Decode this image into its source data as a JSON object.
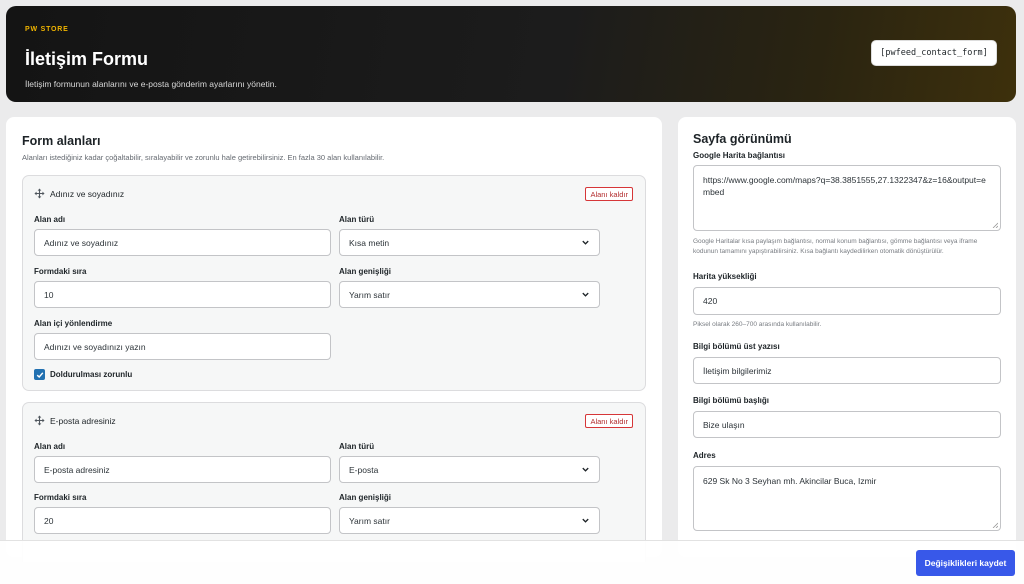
{
  "header": {
    "brand": "PW STORE",
    "title": "İletişim Formu",
    "subtitle": "İletişim formunun alanlarını ve e-posta gönderim ayarlarını yönetin.",
    "shortcode": "[pwfeed_contact_form]",
    "accent_color": "#f0b400"
  },
  "form_fields": {
    "title": "Form alanları",
    "description": "Alanları istediğiniz kadar çoğaltabilir, sıralayabilir ve zorunlu hale getirebilirsiniz. En fazla 30 alan kullanılabilir.",
    "labels": {
      "name": "Alan adı",
      "type": "Alan türü",
      "order": "Formdaki sıra",
      "width": "Alan genişliği",
      "placeholder": "Alan içi yönlendirme",
      "required": "Doldurulması zorunlu",
      "remove": "Alanı kaldır"
    },
    "fields": [
      {
        "heading": "Adınız ve soyadınız",
        "name": "Adınız ve soyadınız",
        "type": "Kısa metin",
        "order": "10",
        "width": "Yarım satır",
        "placeholder": "Adınızı ve soyadınızı yazın",
        "required": true
      },
      {
        "heading": "E-posta adresiniz",
        "name": "E-posta adresiniz",
        "type": "E-posta",
        "order": "20",
        "width": "Yarım satır"
      }
    ]
  },
  "page_view": {
    "title": "Sayfa görünümü",
    "map_link_label": "Google Harita bağlantısı",
    "map_link_value": "https://www.google.com/maps?q=38.3851555,27.1322347&z=16&output=embed",
    "map_link_help": "Google Haritalar kısa paylaşım bağlantısı, normal konum bağlantısı, gömme bağlantısı veya iframe kodunun tamamını yapıştırabilirsiniz. Kısa bağlantı kaydedilirken otomatik dönüştürülür.",
    "map_height_label": "Harita yüksekliği",
    "map_height_value": "420",
    "map_height_help": "Piksel olarak 260–700 arasında kullanılabilir.",
    "info_top_label": "Bilgi bölümü üst yazısı",
    "info_top_value": "İletişim bilgilerimiz",
    "info_heading_label": "Bilgi bölümü başlığı",
    "info_heading_value": "Bize ulaşın",
    "address_label": "Adres",
    "address_value": "629 Sk No 3 Seyhan mh. Akincilar Buca, Izmir"
  },
  "footer": {
    "save_label": "Değişiklikleri kaydet",
    "button_color": "#3858e9"
  }
}
